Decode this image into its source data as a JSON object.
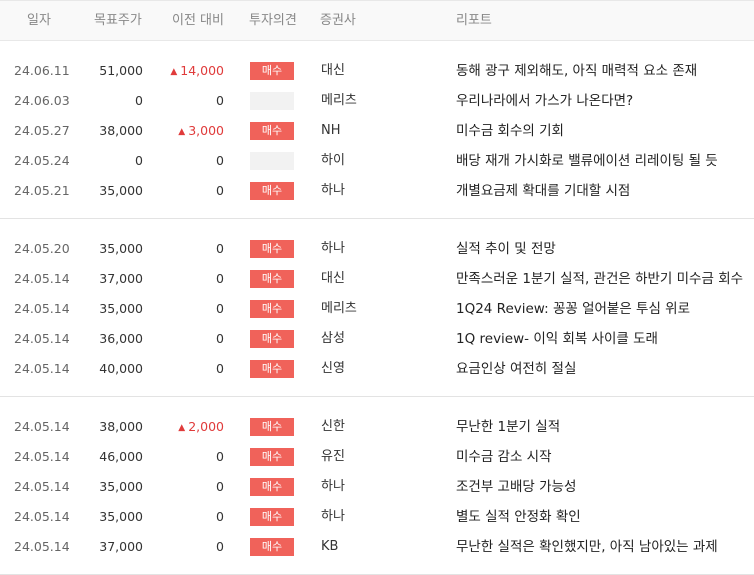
{
  "headers": {
    "date": "일자",
    "target": "목표주가",
    "change": "이전 대비",
    "opinion": "투자의견",
    "broker": "증권사",
    "report": "리포트"
  },
  "groups": [
    [
      {
        "date": "24.06.11",
        "target": "51,000",
        "change": "14,000",
        "up": true,
        "opinion": "매수",
        "broker": "대신",
        "report": "동해 광구 제외해도, 아직 매력적 요소 존재"
      },
      {
        "date": "24.06.03",
        "target": "0",
        "change": "0",
        "up": false,
        "opinion": "",
        "broker": "메리츠",
        "report": "우리나라에서 가스가 나온다면?"
      },
      {
        "date": "24.05.27",
        "target": "38,000",
        "change": "3,000",
        "up": true,
        "opinion": "매수",
        "broker": "NH",
        "report": "미수금 회수의 기회"
      },
      {
        "date": "24.05.24",
        "target": "0",
        "change": "0",
        "up": false,
        "opinion": "",
        "broker": "하이",
        "report": "배당 재개 가시화로 밸류에이션 리레이팅 될 듯"
      },
      {
        "date": "24.05.21",
        "target": "35,000",
        "change": "0",
        "up": false,
        "opinion": "매수",
        "broker": "하나",
        "report": "개별요금제 확대를 기대할 시점"
      }
    ],
    [
      {
        "date": "24.05.20",
        "target": "35,000",
        "change": "0",
        "up": false,
        "opinion": "매수",
        "broker": "하나",
        "report": "실적 추이 및 전망"
      },
      {
        "date": "24.05.14",
        "target": "37,000",
        "change": "0",
        "up": false,
        "opinion": "매수",
        "broker": "대신",
        "report": "만족스러운 1분기 실적, 관건은 하반기 미수금 회수"
      },
      {
        "date": "24.05.14",
        "target": "35,000",
        "change": "0",
        "up": false,
        "opinion": "매수",
        "broker": "메리츠",
        "report": "1Q24 Review: 꽁꽁 얼어붙은 투심 위로"
      },
      {
        "date": "24.05.14",
        "target": "36,000",
        "change": "0",
        "up": false,
        "opinion": "매수",
        "broker": "삼성",
        "report": "1Q review- 이익 회복 사이클 도래"
      },
      {
        "date": "24.05.14",
        "target": "40,000",
        "change": "0",
        "up": false,
        "opinion": "매수",
        "broker": "신영",
        "report": "요금인상 여전히 절실"
      }
    ],
    [
      {
        "date": "24.05.14",
        "target": "38,000",
        "change": "2,000",
        "up": true,
        "opinion": "매수",
        "broker": "신한",
        "report": "무난한 1분기 실적"
      },
      {
        "date": "24.05.14",
        "target": "46,000",
        "change": "0",
        "up": false,
        "opinion": "매수",
        "broker": "유진",
        "report": "미수금 감소 시작"
      },
      {
        "date": "24.05.14",
        "target": "35,000",
        "change": "0",
        "up": false,
        "opinion": "매수",
        "broker": "하나",
        "report": "조건부 고배당 가능성"
      },
      {
        "date": "24.05.14",
        "target": "35,000",
        "change": "0",
        "up": false,
        "opinion": "매수",
        "broker": "하나",
        "report": "별도 실적 안정화 확인"
      },
      {
        "date": "24.05.14",
        "target": "37,000",
        "change": "0",
        "up": false,
        "opinion": "매수",
        "broker": "KB",
        "report": "무난한 실적은 확인했지만, 아직 남아있는 과제"
      }
    ]
  ],
  "icons": {
    "up": "triangle-up"
  },
  "colors": {
    "up": "#e03b3b",
    "buy_badge": "#f0625a",
    "empty_badge": "#f2f2f2"
  }
}
